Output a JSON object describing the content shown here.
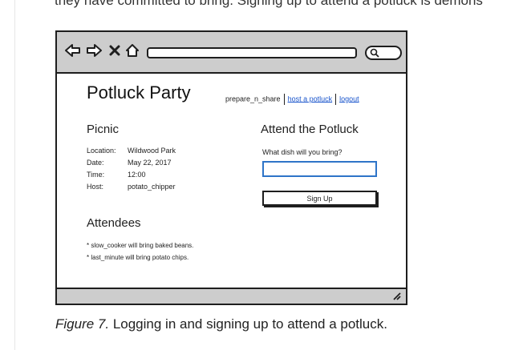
{
  "article": {
    "top_text": "they have committed to bring. Signing up to attend a potluck is demons",
    "caption_label": "Figure 7.",
    "caption_text": " Logging in and signing up to attend a potluck."
  },
  "toolbar": {
    "icons": [
      "back-arrow-icon",
      "forward-arrow-icon",
      "close-icon",
      "home-icon",
      "search-icon"
    ],
    "address_value": ""
  },
  "app": {
    "title": "Potluck Party",
    "nav": {
      "user": "prepare_n_share",
      "host_link": "host a potluck",
      "logout_link": "logout"
    }
  },
  "event": {
    "title": "Picnic",
    "details": [
      {
        "label": "Location:",
        "value": "Wildwood Park"
      },
      {
        "label": "Date:",
        "value": "May 22, 2017"
      },
      {
        "label": "Time:",
        "value": "12:00"
      },
      {
        "label": "Host:",
        "value": "potato_chipper"
      }
    ]
  },
  "attend": {
    "heading": "Attend the Potluck",
    "prompt": "What dish will you bring?",
    "dish_value": "",
    "button_label": "Sign Up"
  },
  "attendees": {
    "heading": "Attendees",
    "items": [
      "* slow_cooker will bring baked beans.",
      "* last_minute will bring potato chips."
    ]
  },
  "colors": {
    "chrome": "#cdcdcd",
    "border": "#1e1e1e",
    "link": "#1a55cc",
    "input_focus": "#2e74c8"
  }
}
